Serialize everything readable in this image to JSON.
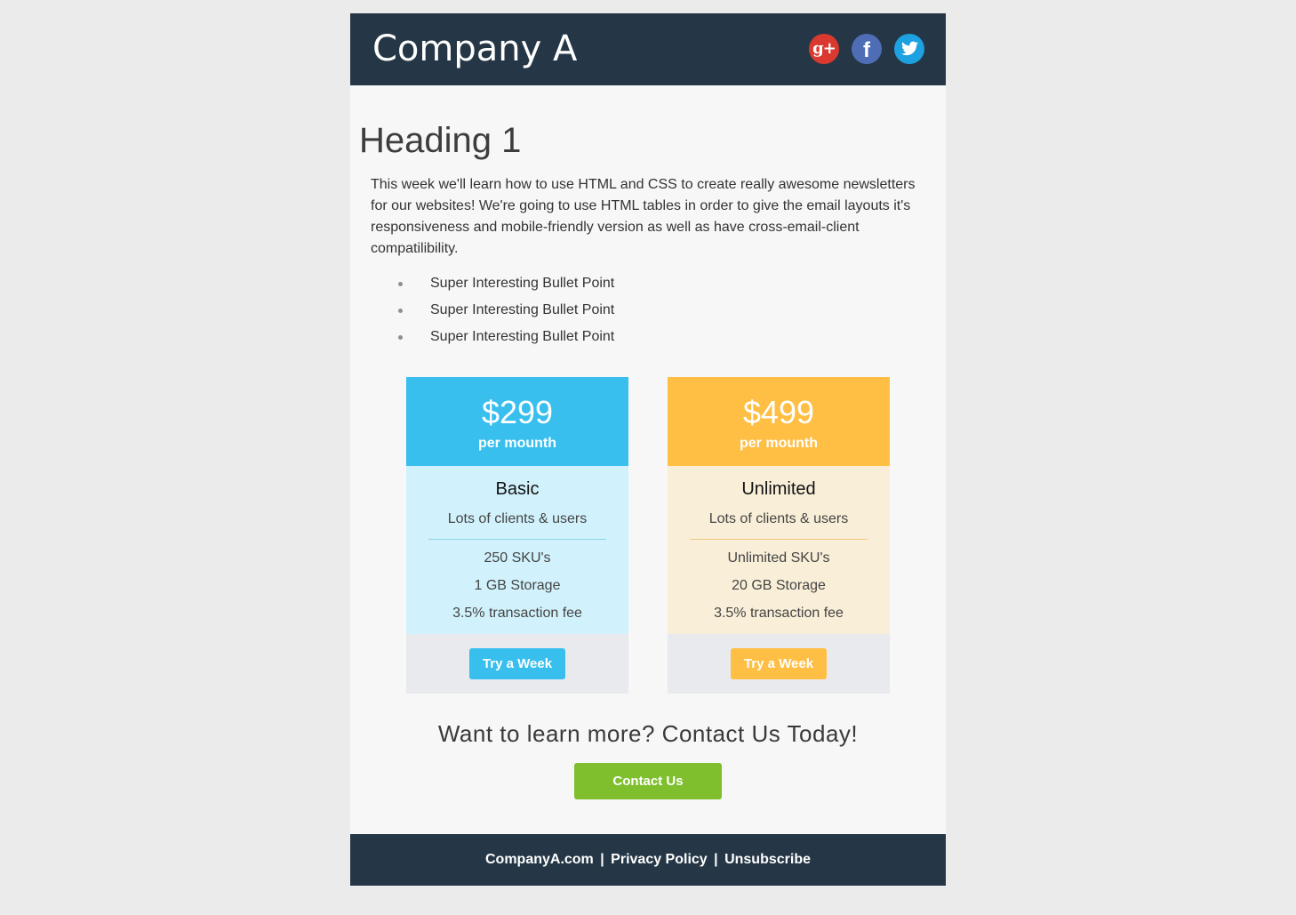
{
  "header": {
    "company_name": "Company A",
    "social": [
      {
        "icon": "google-plus-icon",
        "glyph": "g+",
        "color": "#d9392e"
      },
      {
        "icon": "facebook-icon",
        "glyph": "f",
        "color": "#4e6db5"
      },
      {
        "icon": "twitter-icon",
        "glyph": "",
        "color": "#1da1e0"
      }
    ]
  },
  "main": {
    "heading": "Heading 1",
    "intro": "This week we'll learn how to use HTML and CSS to create really awesome newsletters for our websites! We're going to use HTML tables in order to give the email layouts it's responsiveness and mobile-friendly version as well as have cross-email-client compatilibility.",
    "bullets": [
      "Super Interesting Bullet Point",
      "Super Interesting Bullet Point",
      "Super Interesting Bullet Point"
    ]
  },
  "plans": [
    {
      "price": "$299",
      "period": "per mounth",
      "name": "Basic",
      "tagline": "Lots of clients & users",
      "features": [
        "250 SKU's",
        "1 GB Storage",
        "3.5% transaction fee"
      ],
      "button": "Try a Week",
      "accent": "#38bfee",
      "body_color": "#d1f2fc"
    },
    {
      "price": "$499",
      "period": "per mounth",
      "name": "Unlimited",
      "tagline": "Lots of clients & users",
      "features": [
        "Unlimited SKU's",
        "20 GB Storage",
        "3.5% transaction fee"
      ],
      "button": "Try a Week",
      "accent": "#ffbe44",
      "body_color": "#f9efd8"
    }
  ],
  "cta": {
    "text": "Want to learn more? Contact Us Today!",
    "button": "Contact Us",
    "button_color": "#7fbf2e"
  },
  "footer": {
    "links": [
      "CompanyA.com",
      "Privacy Policy",
      "Unsubscribe"
    ],
    "separator": "|",
    "background": "#253746"
  }
}
